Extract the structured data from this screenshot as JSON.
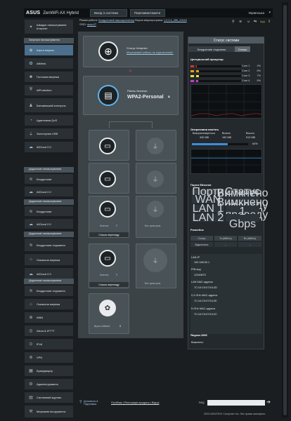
{
  "header": {
    "logo": "ASUS",
    "product": "ZenWiFi AX Hybrid",
    "logout": "Вихід із системи",
    "reboot": "Перезавантажити",
    "language": "Українська"
  },
  "infobar": {
    "mode_label": "Режим роботи:",
    "mode_value": "Бездротовий маршрутизатор",
    "fw_label": "Версія мікропрограми:",
    "fw_value": "1.0.0.4_386_41643",
    "ssid_label": "SSID:",
    "ssid_value": "asus-IP",
    "app_label": "App"
  },
  "sidebar": {
    "quick": "Швидке налаштування Інтернет",
    "general_head": "Загальні налаштування",
    "general": [
      "Карта мережі",
      "AiMesh",
      "Гостьова мережа",
      "AiProtection",
      "Батьківський контроль",
      "Адаптивна QoS",
      "Застосунки USB",
      "AiCloud 2.0"
    ],
    "head2": "Додаткові налаштування",
    "g2": [
      "Бездротове",
      "AiCloud 2.0"
    ],
    "head3": "Додаткові налаштування",
    "g3": [
      "Бездротове",
      "AiCloud 2.0"
    ],
    "head4": "Додаткові налаштування",
    "g4": [
      "Бездротове з'єднання",
      "Локальна мережа",
      "AiCloud 2.0"
    ],
    "head5": "Додаткові налаштування",
    "g5": [
      "Бездротове з'єднання",
      "Локальна мережа",
      "WAN",
      "Alexa & IFTTT",
      "IPv6",
      "VPN",
      "Брандмауер",
      "Адміністрування",
      "Системний журнал",
      "Мережеві інструменти"
    ]
  },
  "map": {
    "internet_status_label": "Статус Інтернет:",
    "internet_status_value": "Мережевий кабель не підключений.",
    "security_label": "Рівень безпеки:",
    "security_value": "WPA2-Personal",
    "clients_label": "Клієнти:",
    "clients_value": "?",
    "clients_list": "Список перегляду",
    "no_device": "Без пристрою",
    "aimesh": "Вузол AiMesh:",
    "aimesh_value": "0"
  },
  "status": {
    "title": "Статус системи",
    "tabs": [
      "Бездротове з'єднання",
      "Статус"
    ],
    "cpu_title": "Центральний процесор",
    "cores": [
      {
        "name": "Core 1",
        "pct": "2%",
        "val": 0.02,
        "color": "#d4342c"
      },
      {
        "name": "Core 2",
        "pct": "6%",
        "val": 0.06,
        "color": "#f29a1b"
      },
      {
        "name": "Core 3",
        "pct": "7%",
        "val": 0.07,
        "color": "#e7e434"
      },
      {
        "name": "Core 4",
        "pct": "5%",
        "val": 0.05,
        "color": "#c53ad0"
      }
    ],
    "ram_title": "Оперативна пам'ять",
    "ram_used_label": "Використовується",
    "ram_used": "330 MB",
    "ram_free_label": "Вільно",
    "ram_free": "182 MB",
    "ram_total_label": "Всього",
    "ram_total": "512 MB",
    "ram_pct": "64%",
    "ram_val": 0.64,
    "eth_title": "Порти Ethernet",
    "eth_cols": [
      "Порти",
      "Статус"
    ],
    "eth_rows": [
      [
        "WAN",
        "Вимкнено з проводу"
      ],
      [
        "LAN 1",
        "Вимкнено з проводу"
      ],
      [
        "LAN 2",
        "1 Gbps"
      ]
    ],
    "pl_title": "Powerline",
    "pl_cols": [
      "Статус",
      "Tx (Мбіт/с)",
      "Rx (Мбіт/с)"
    ],
    "pl_row": [
      "Відключено",
      "--",
      "--"
    ],
    "lan_ip_label": "LAN IP",
    "lan_ip": "192.168.50.1",
    "pin_label": "PIN-код",
    "pin": "12345670",
    "lan_mac_label": "LAN MAC-адреса",
    "lan_mac": "7C:10:C9:07:E4:2D",
    "mac24_label": "2,4 GHz MAC-адреса",
    "mac24": "7C:10:C9:07:E4:2E",
    "mac5_label": "5 GHz MAC-адреса",
    "mac5": "7C:10:C9:07:E4:2C",
    "ddns_title": "Яндекс.DNS",
    "ddns_value": "Вимкнено"
  },
  "footer": {
    "help": "Допомога & Підтримка",
    "links": "Посібник | Реєстрація продукту | Відгук",
    "faq": "FAQ",
    "copyright": "2020 ASUSTeK Computer Inc. Всі права захищено."
  }
}
